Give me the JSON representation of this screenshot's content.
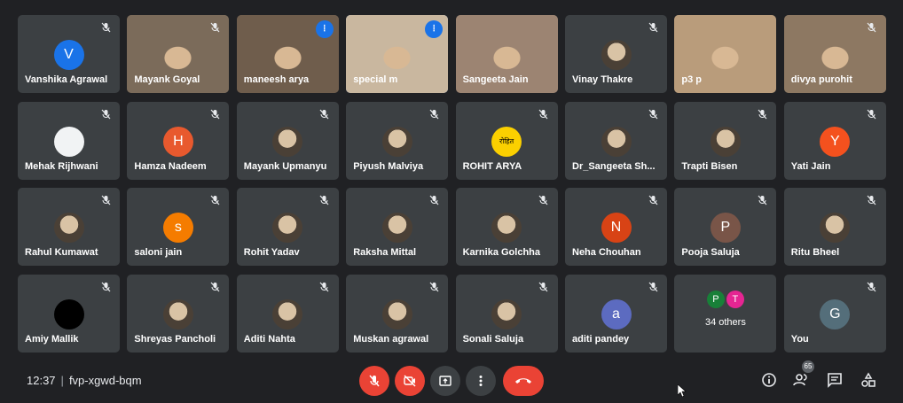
{
  "participants": [
    {
      "name": "Vanshika Agrawal",
      "avatar_letter": "V",
      "avatar_color": "#1a73e8"
    },
    {
      "name": "Mayank Goyal",
      "video_color": "#7b6b5a"
    },
    {
      "name": "maneesh arya",
      "video_color": "#6f5d4c"
    },
    {
      "name": "special m",
      "video_color": "#c9b79f"
    },
    {
      "name": "Sangeeta Jain",
      "video_color": "#9c8472"
    },
    {
      "name": "Vinay Thakre"
    },
    {
      "name": "p3 p",
      "video_color": "#b99c7b"
    },
    {
      "name": "divya purohit",
      "video_color": "#8d7862"
    },
    {
      "name": "Mehak Rijhwani",
      "avatar_color": "#f1f3f4"
    },
    {
      "name": "Hamza Nadeem",
      "avatar_letter": "H",
      "avatar_color": "#e8592e"
    },
    {
      "name": "Mayank Upmanyu"
    },
    {
      "name": "Piyush Malviya"
    },
    {
      "name": "ROHIT ARYA",
      "avatar_letter": "रोहित",
      "avatar_color": "#fbd000"
    },
    {
      "name": "Dr_Sangeeta Sh..."
    },
    {
      "name": "Trapti Bisen"
    },
    {
      "name": "Yati Jain",
      "avatar_letter": "Y",
      "avatar_color": "#f4511e"
    },
    {
      "name": "Rahul Kumawat"
    },
    {
      "name": "saloni jain",
      "avatar_letter": "s",
      "avatar_color": "#f57c00"
    },
    {
      "name": "Rohit Yadav"
    },
    {
      "name": "Raksha Mittal"
    },
    {
      "name": "Karnika Golchha"
    },
    {
      "name": "Neha Chouhan",
      "avatar_letter": "N",
      "avatar_color": "#d84315"
    },
    {
      "name": "Pooja Saluja",
      "avatar_letter": "P",
      "avatar_color": "#795548"
    },
    {
      "name": "Ritu Bheel"
    },
    {
      "name": "Amiy Mallik",
      "avatar_color": "#000000"
    },
    {
      "name": "Shreyas Pancholi"
    },
    {
      "name": "Aditi Nahta"
    },
    {
      "name": "Muskan agrawal"
    },
    {
      "name": "Sonali Saluja"
    },
    {
      "name": "aditi pandey",
      "avatar_letter": "a",
      "avatar_color": "#5c6bc0"
    },
    {
      "others": "34 others",
      "mini": [
        {
          "letter": "P",
          "color": "#188038"
        },
        {
          "letter": "T",
          "color": "#e52592"
        }
      ]
    },
    {
      "name": "You",
      "avatar_letter": "G",
      "avatar_color": "#546e7a"
    }
  ],
  "meeting": {
    "time": "12:37",
    "code": "fvp-xgwd-bqm",
    "people_count": "65"
  },
  "icons": {
    "mic_off": "mic-off-icon",
    "speaking": "audio-wave-icon",
    "cam_off": "camera-off-icon",
    "present": "present-screen-icon",
    "more": "more-options-icon",
    "hangup": "hang-up-icon",
    "info": "info-icon",
    "people": "people-icon",
    "chat": "chat-icon",
    "activities": "activities-icon"
  },
  "colors": {
    "red": "#ea4335",
    "tile": "#3c4043",
    "background": "#202124",
    "active_border": "#8ab4f8"
  }
}
